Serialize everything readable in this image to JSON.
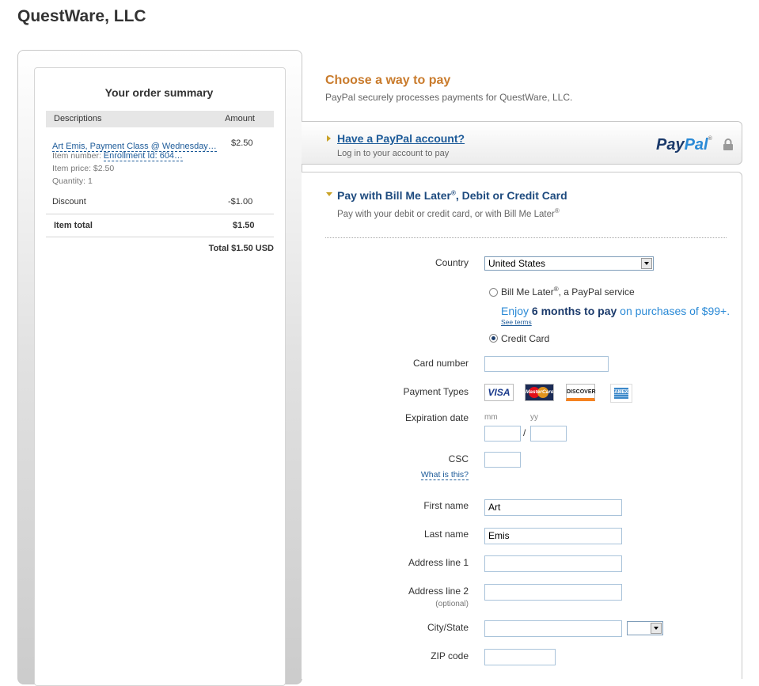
{
  "merchant_title": "QuestWare, LLC",
  "summary": {
    "heading": "Your order summary",
    "col_description": "Descriptions",
    "col_amount": "Amount",
    "item_name": "Art Emis, Payment Class @ Wednesday…",
    "item_amount": "$2.50",
    "item_number_label": "Item number:",
    "item_number_value": "Enrollment Id: 604…",
    "item_price": "Item price: $2.50",
    "quantity": "Quantity: 1",
    "discount_label": "Discount",
    "discount_amount": "-$1.00",
    "item_total_label": "Item total",
    "item_total_amount": "$1.50",
    "grand_total": "Total $1.50 USD"
  },
  "choose": {
    "title": "Choose a way to pay",
    "subtitle": "PayPal securely processes payments for QuestWare, LLC."
  },
  "paypal_account": {
    "link": "Have a PayPal account?",
    "subtitle": "Log in to your account to pay",
    "logo_part1": "Pay",
    "logo_part2": "Pal",
    "logo_tm": "®"
  },
  "bml": {
    "title": "Pay with Bill Me Later",
    "title_sup": "®",
    "title_rest": ", Debit or Credit Card",
    "subtitle": "Pay with your debit or credit card, or with Bill Me Later",
    "subtitle_sup": "®"
  },
  "form": {
    "country_label": "Country",
    "country_value": "United States",
    "bml_option_label": "Bill Me Later",
    "bml_option_sup": "®",
    "bml_option_rest": ", a PayPal service",
    "bml_promo_1": "Enjoy",
    "bml_promo_2": "6 months to pay",
    "bml_promo_3": "on purchases of $99+.",
    "see_terms": "See terms",
    "credit_card_label": "Credit Card",
    "card_number_label": "Card number",
    "card_number_value": "",
    "payment_types_label": "Payment Types",
    "card_visa": "VISA",
    "card_mastercard": "MasterCard",
    "card_discover": "DISCOVER",
    "card_amex": "AMEX",
    "expiration_label": "Expiration date",
    "mm_label": "mm",
    "yy_label": "yy",
    "exp_separator": "/",
    "csc_label": "CSC",
    "csc_help": "What is this?",
    "first_name_label": "First name",
    "first_name_value": "Art",
    "last_name_label": "Last name",
    "last_name_value": "Emis",
    "address1_label": "Address line 1",
    "address1_value": "",
    "address2_label": "Address line 2",
    "address2_optional": "(optional)",
    "address2_value": "",
    "city_state_label": "City/State",
    "city_value": "",
    "state_value": "",
    "zip_label": "ZIP code",
    "zip_value": ""
  },
  "colors": {
    "accent_orange": "#c97b2c",
    "link_blue": "#1d5b99",
    "heading_blue": "#1d4a7e"
  }
}
